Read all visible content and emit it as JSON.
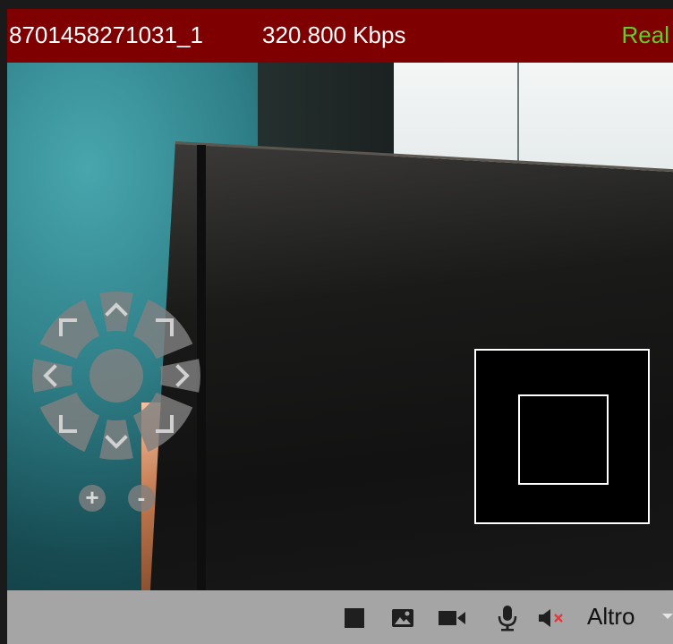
{
  "header": {
    "camera_id": "8701458271031_1",
    "bitrate": "320.800 Kbps",
    "stream_mode": "Real",
    "stream_mode_color": "#5fd02a",
    "background_color": "#7f0000"
  },
  "ptz": {
    "directions": [
      "up",
      "up-right",
      "right",
      "down-right",
      "down",
      "down-left",
      "left",
      "up-left"
    ],
    "center": "ptz-center",
    "zoom_in_label": "+",
    "zoom_out_label": "-"
  },
  "minimap": {
    "frame_color": "#ffffff"
  },
  "toolbar": {
    "icons": [
      "stop-icon",
      "snapshot-icon",
      "record-icon",
      "microphone-icon",
      "speaker-muted-icon"
    ],
    "more_label": "Altro",
    "background_color": "#a5a5a5"
  }
}
